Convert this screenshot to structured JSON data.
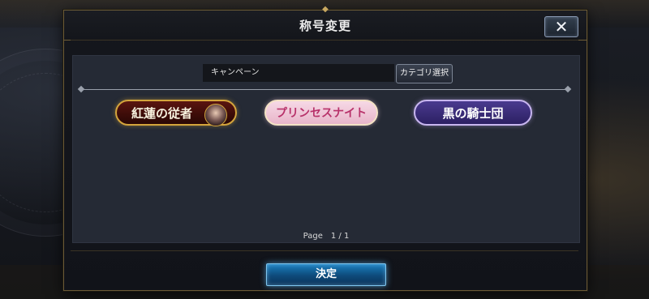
{
  "modal": {
    "title": "称号変更",
    "close_label": "✕"
  },
  "filter": {
    "current_category": "キャンペーン",
    "category_button_label": "カテゴリ選択"
  },
  "titles": [
    {
      "label": "紅蓮の従者"
    },
    {
      "label": "プリンセスナイト"
    },
    {
      "label": "黒の騎士団"
    }
  ],
  "pagination": {
    "text": "Page　1 / 1"
  },
  "actions": {
    "confirm_label": "決定"
  },
  "colors": {
    "confirm_button": "#1a7fbf",
    "frame_gold": "#6b5a36",
    "panel_bg": "#252a35"
  }
}
